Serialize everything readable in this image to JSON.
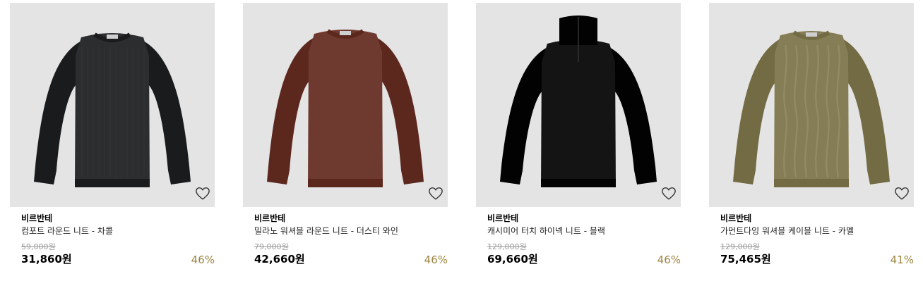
{
  "theme": {
    "discount_color": "#9c8540",
    "thumb_bg": "#e4e4e4"
  },
  "products": [
    {
      "brand": "비르반테",
      "name": "컴포트 라운드 니트 - 차콜",
      "original_price": "59,000원",
      "price": "31,860원",
      "discount": "46%",
      "color": "#2b2d2f",
      "style": "crew-knit",
      "wish_icon": "heart-outline-icon"
    },
    {
      "brand": "비르반테",
      "name": "밀라노 워셔블 라운드 니트 - 더스티 와인",
      "original_price": "79,000원",
      "price": "42,660원",
      "discount": "46%",
      "color": "#6e3a30",
      "style": "crew-fine",
      "wish_icon": "heart-outline-icon"
    },
    {
      "brand": "비르반테",
      "name": "캐시미어 터치 하이넥 니트 - 블랙",
      "original_price": "129,000원",
      "price": "69,660원",
      "discount": "46%",
      "color": "#141414",
      "style": "highneck",
      "wish_icon": "heart-outline-icon"
    },
    {
      "brand": "비르반테",
      "name": "가먼트다잉 워셔블 케이블 니트 - 카멜",
      "original_price": "129,000원",
      "price": "75,465원",
      "discount": "41%",
      "color": "#857d55",
      "style": "cable",
      "wish_icon": "heart-outline-icon"
    }
  ]
}
